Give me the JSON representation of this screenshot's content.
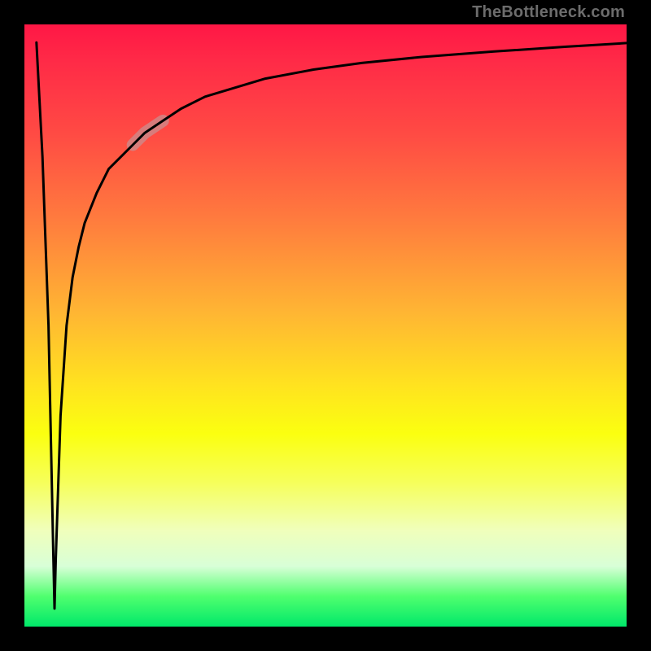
{
  "watermark": "TheBottleneck.com",
  "colors": {
    "gradient_top": "#ff1745",
    "gradient_mid": "#ffe31f",
    "gradient_bottom": "#00e86a",
    "curve": "#000000",
    "highlight": "#c98d8f",
    "frame": "#000000"
  },
  "chart_data": {
    "type": "line",
    "title": "",
    "xlabel": "",
    "ylabel": "",
    "xlim": [
      0,
      100
    ],
    "ylim": [
      0,
      100
    ],
    "grid": false,
    "legend": false,
    "annotations": [
      {
        "text": "TheBottleneck.com",
        "position": "top-right"
      }
    ],
    "notes": "Background is a vertical red→yellow→green gradient. Curve is drawn in black: it starts at top-left (~x2,y97), drops sharply to a narrow trough near the bottom (~x5,y3), then climbs steeply and asymptotically toward y≈97 at the right edge. A short pale segment highlights x≈18–23 on the rising limb.",
    "series": [
      {
        "name": "bottleneck-curve",
        "x": [
          2,
          3,
          4,
          4.8,
          5,
          5.2,
          6,
          7,
          8,
          9,
          10,
          12,
          14,
          16,
          18,
          20,
          23,
          26,
          30,
          35,
          40,
          48,
          56,
          66,
          78,
          90,
          100
        ],
        "y": [
          97,
          78,
          50,
          12,
          3,
          11,
          35,
          50,
          58,
          63,
          67,
          72,
          76,
          78,
          80,
          82,
          84,
          86,
          88,
          89.5,
          91,
          92.5,
          93.6,
          94.6,
          95.5,
          96.3,
          96.9
        ]
      }
    ],
    "highlight_range_x": [
      18,
      23
    ]
  }
}
